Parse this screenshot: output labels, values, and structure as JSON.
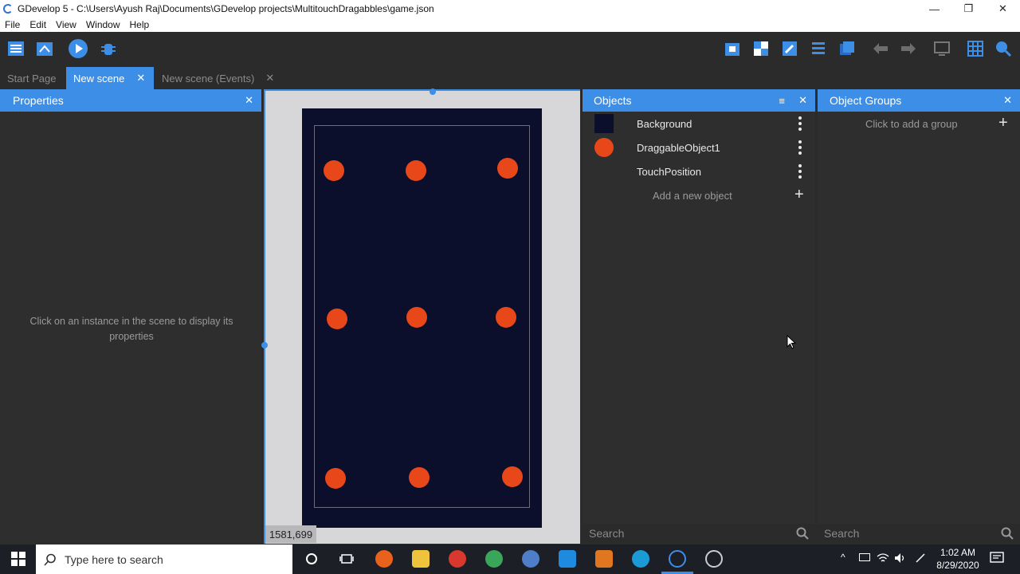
{
  "window": {
    "title": "GDevelop 5 - C:\\Users\\Ayush Raj\\Documents\\GDevelop projects\\MultitouchDragabbles\\game.json",
    "minimize": "—",
    "restore": "❐",
    "close": "✕"
  },
  "menu": {
    "items": [
      "File",
      "Edit",
      "View",
      "Window",
      "Help"
    ]
  },
  "tabs": [
    {
      "label": "Start Page"
    },
    {
      "label": "New scene",
      "close": "✕"
    },
    {
      "label": "New scene (Events)",
      "close": "✕"
    }
  ],
  "properties": {
    "title": "Properties",
    "close": "✕",
    "empty_message": "Click on an instance in the scene to display its properties"
  },
  "scene": {
    "cursor_coords": "1581,699"
  },
  "objects": {
    "title": "Objects",
    "close": "✕",
    "items": [
      {
        "name": "Background",
        "thumb": "#0b0f2b"
      },
      {
        "name": "DraggableObject1",
        "thumb": "#e8471a"
      },
      {
        "name": "TouchPosition",
        "thumb": ""
      }
    ],
    "add_label": "Add a new object",
    "search_placeholder": "Search"
  },
  "groups": {
    "title": "Object Groups",
    "close": "✕",
    "add_label": "Click to add a group",
    "search_placeholder": "Search"
  },
  "taskbar": {
    "search_placeholder": "Type here to search",
    "time": "1:02 AM",
    "date": "8/29/2020"
  },
  "colors": {
    "accent": "#3d8ee6",
    "scene_bg": "#0b0f2b",
    "ball": "#e8471a"
  }
}
